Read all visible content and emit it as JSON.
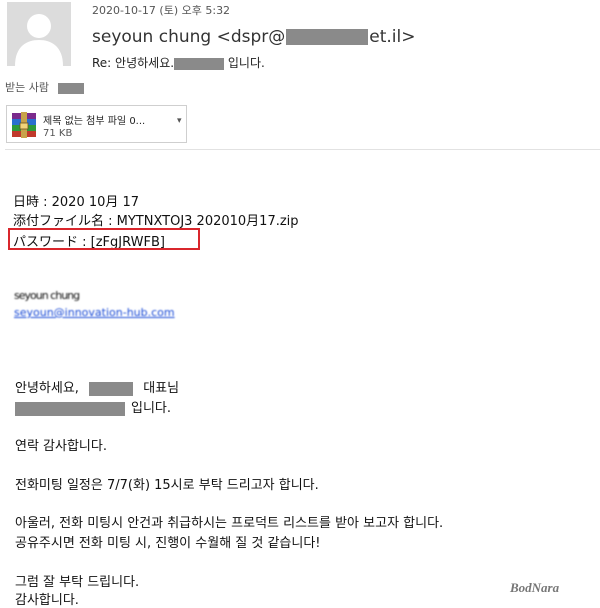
{
  "header": {
    "date": "2020-10-17 (토) 오후 5:32",
    "sender_name_prefix": "seyoun chung <dspr@",
    "sender_domain_suffix": "et.il>",
    "subject_prefix": "Re: 안녕하세요.",
    "subject_suffix": " 입니다.",
    "recipient_label": "받는 사람"
  },
  "attachment": {
    "name": "제목 없는 첨부 파일 0...",
    "size": "71 KB",
    "icon": "winrar-archive-icon",
    "chevron": "▾"
  },
  "body": {
    "date_line": "日時 : 2020 10月 17",
    "file_line": "添付ファイル名 : MYTNXTOJ3 202010月17.zip",
    "password_line": "パスワード : [zFgJRWFB]",
    "signature_name": "seyoun chung",
    "signature_link": "seyoun@innovation-hub.com",
    "greeting_prefix": "안녕하세요,",
    "greeting_suffix": "대표님",
    "intro_suffix": "입니다.",
    "thanks": "연락 감사합니다.",
    "meeting": "전화미팅 일정은 7/7(화) 15시로 부탁 드리고자 합니다.",
    "request_1": "아울러,  전화 미팅시 안건과 취급하시는 프로덕트 리스트를 받아 보고자 합니다.",
    "request_2": "공유주시면 전화 미팅 시, 진행이 수월해 질 것 같습니다!",
    "closing": "그럼 잘 부탁 드립니다.",
    "closing_2": "감사합니다."
  },
  "watermark": "BodNara",
  "colors": {
    "highlight_border": "#d9262c",
    "link": "#1a4bd6",
    "redaction": "#8a8a8a"
  }
}
